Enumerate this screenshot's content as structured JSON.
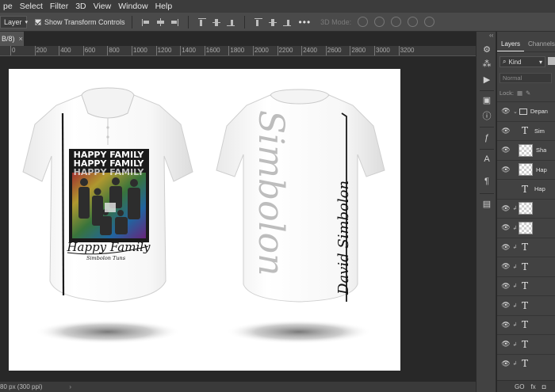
{
  "menu": [
    "pe",
    "Select",
    "Filter",
    "3D",
    "View",
    "Window",
    "Help"
  ],
  "options": {
    "tool_select": "Layer",
    "show_transform_label": "Show Transform Controls",
    "more": "•••",
    "mode_3d": "3D Mode:"
  },
  "doc_tab": {
    "title": "B/8)",
    "close": "×"
  },
  "ruler_labels": [
    "0",
    "200",
    "400",
    "600",
    "800",
    "1000",
    "1200",
    "1400",
    "1600",
    "1800",
    "2000",
    "2200",
    "2400",
    "2600",
    "2800",
    "3000",
    "3200"
  ],
  "status": {
    "info": "80 px (300 ppi)",
    "arrow": "›"
  },
  "panel": {
    "tabs": [
      "Layers",
      "Channels"
    ],
    "filter_label": "Kind",
    "blend_mode": "Normal",
    "lock_label": "Lock:",
    "layers": [
      {
        "type": "group",
        "name": "Depan",
        "visible": true
      },
      {
        "type": "text",
        "name": "Sim",
        "visible": true
      },
      {
        "type": "image",
        "name": "Sha",
        "visible": true
      },
      {
        "type": "image",
        "name": "Hap",
        "visible": true
      },
      {
        "type": "text",
        "name": "Hap",
        "visible": false
      },
      {
        "type": "image",
        "name": "",
        "visible": true
      },
      {
        "type": "image",
        "name": "",
        "visible": true
      },
      {
        "type": "text",
        "name": "",
        "visible": true
      },
      {
        "type": "text",
        "name": "",
        "visible": true
      },
      {
        "type": "text",
        "name": "",
        "visible": true
      },
      {
        "type": "text",
        "name": "",
        "visible": true
      },
      {
        "type": "text",
        "name": "",
        "visible": true
      },
      {
        "type": "text",
        "name": "",
        "visible": true
      },
      {
        "type": "text",
        "name": "",
        "visible": true
      }
    ],
    "footer": [
      "GO",
      "fx",
      "◘"
    ]
  },
  "design": {
    "front_title": "HAPPY FAMILY",
    "front_script": "Happy Family",
    "front_sub": "Simbolon Tuns",
    "back_big": "Simbolon",
    "back_name": "David Simbolon"
  },
  "colors": {
    "canvas_bg": "#282828",
    "panel_bg": "#424242",
    "menu_bg": "#3c3c3c"
  }
}
